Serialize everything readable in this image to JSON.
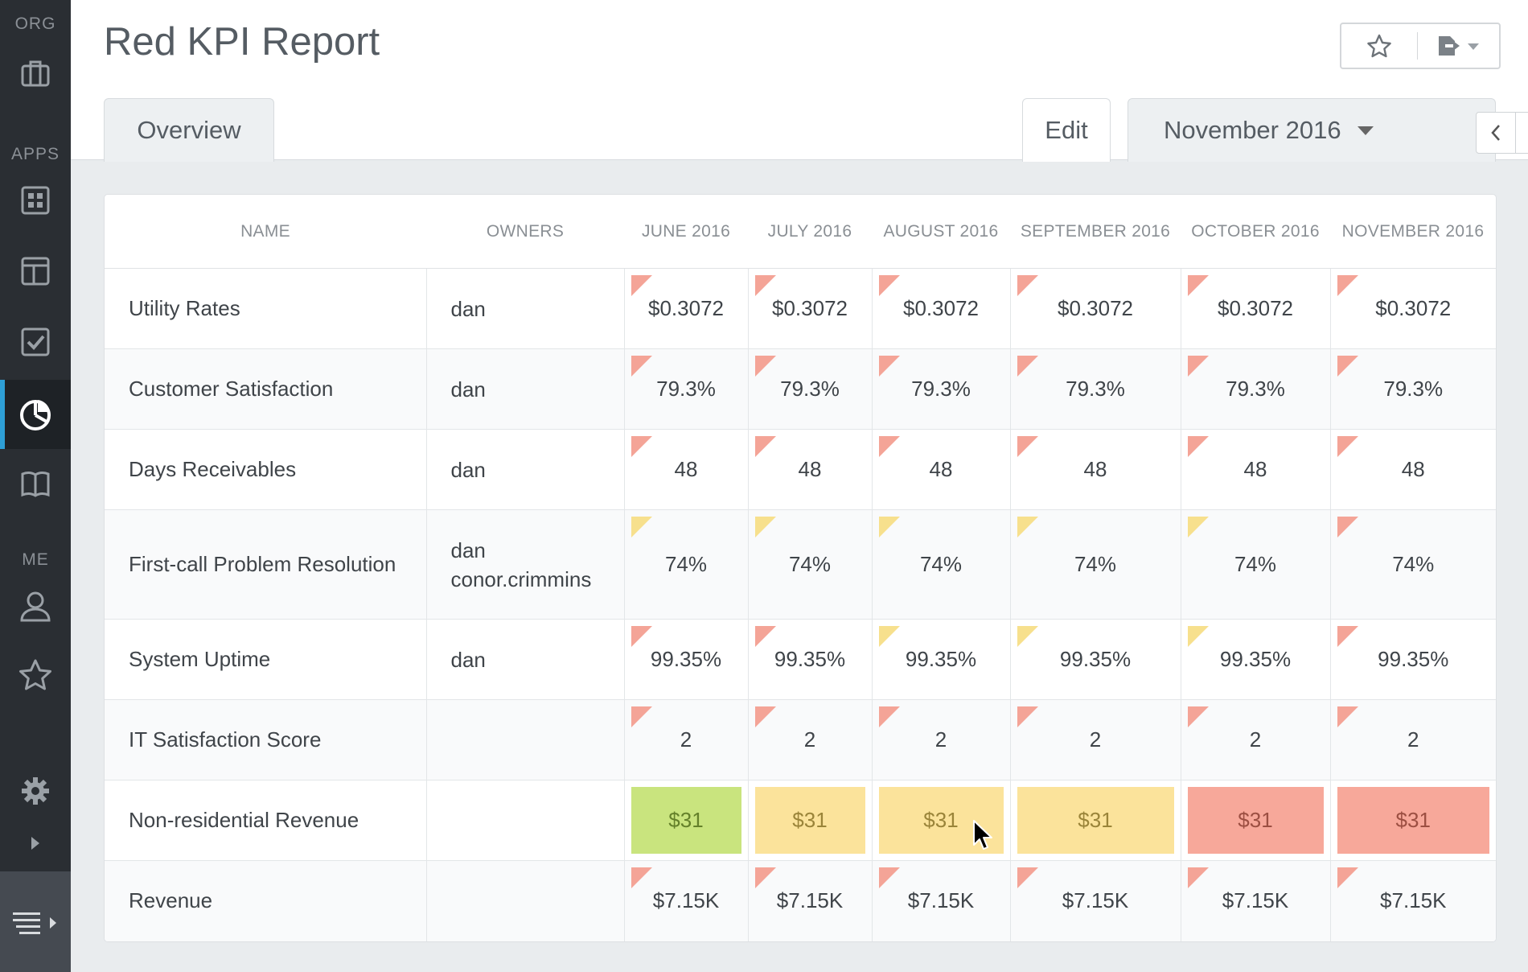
{
  "sidebar": {
    "org_label": "ORG",
    "apps_label": "APPS",
    "me_label": "ME"
  },
  "header": {
    "title": "Red KPI Report"
  },
  "tabs": {
    "overview": "Overview",
    "edit": "Edit",
    "period": "November 2016"
  },
  "table": {
    "headers": [
      "NAME",
      "OWNERS",
      "JUNE 2016",
      "JULY 2016",
      "AUGUST 2016",
      "SEPTEMBER 2016",
      "OCTOBER 2016",
      "NOVEMBER 2016"
    ],
    "rows": [
      {
        "name": "Utility Rates",
        "owners": [
          "dan"
        ],
        "values": [
          "$0.3072",
          "$0.3072",
          "$0.3072",
          "$0.3072",
          "$0.3072",
          "$0.3072"
        ],
        "status": [
          "red",
          "red",
          "red",
          "red",
          "red",
          "red"
        ],
        "style": "flag"
      },
      {
        "name": "Customer Satisfaction",
        "owners": [
          "dan"
        ],
        "values": [
          "79.3%",
          "79.3%",
          "79.3%",
          "79.3%",
          "79.3%",
          "79.3%"
        ],
        "status": [
          "red",
          "red",
          "red",
          "red",
          "red",
          "red"
        ],
        "style": "flag"
      },
      {
        "name": "Days Receivables",
        "owners": [
          "dan"
        ],
        "values": [
          "48",
          "48",
          "48",
          "48",
          "48",
          "48"
        ],
        "status": [
          "red",
          "red",
          "red",
          "red",
          "red",
          "red"
        ],
        "style": "flag"
      },
      {
        "name": "First-call Problem Resolution",
        "owners": [
          "dan",
          "conor.crimmins"
        ],
        "values": [
          "74%",
          "74%",
          "74%",
          "74%",
          "74%",
          "74%"
        ],
        "status": [
          "yellow",
          "yellow",
          "yellow",
          "yellow",
          "yellow",
          "red"
        ],
        "style": "flag"
      },
      {
        "name": "System Uptime",
        "owners": [
          "dan"
        ],
        "values": [
          "99.35%",
          "99.35%",
          "99.35%",
          "99.35%",
          "99.35%",
          "99.35%"
        ],
        "status": [
          "red",
          "red",
          "yellow",
          "yellow",
          "yellow",
          "red"
        ],
        "style": "flag"
      },
      {
        "name": "IT Satisfaction Score",
        "owners": [],
        "values": [
          "2",
          "2",
          "2",
          "2",
          "2",
          "2"
        ],
        "status": [
          "red",
          "red",
          "red",
          "red",
          "red",
          "red"
        ],
        "style": "flag"
      },
      {
        "name": "Non-residential Revenue",
        "owners": [],
        "values": [
          "$31",
          "$31",
          "$31",
          "$31",
          "$31",
          "$31"
        ],
        "status": [
          "green",
          "yellow",
          "yellow",
          "yellow",
          "red",
          "red"
        ],
        "style": "fill"
      },
      {
        "name": "Revenue",
        "owners": [],
        "values": [
          "$7.15K",
          "$7.15K",
          "$7.15K",
          "$7.15K",
          "$7.15K",
          "$7.15K"
        ],
        "status": [
          "red",
          "red",
          "red",
          "red",
          "red",
          "red"
        ],
        "style": "flag"
      }
    ]
  },
  "colors": {
    "flag_red": "#f4a497",
    "flag_yellow": "#f7e08d",
    "fill_green": "#c9e47e",
    "fill_yellow": "#fbe39b",
    "fill_red": "#f7a89a",
    "accent": "#2e9fd6"
  },
  "icons": [
    "briefcase-icon",
    "dashboard-icon",
    "layout-icon",
    "checkbox-icon",
    "pie-chart-icon",
    "book-icon",
    "user-icon",
    "star-icon",
    "gear-icon",
    "chevron-right-icon",
    "menu-list-icon",
    "export-icon",
    "chevron-left-icon",
    "cursor-icon"
  ]
}
